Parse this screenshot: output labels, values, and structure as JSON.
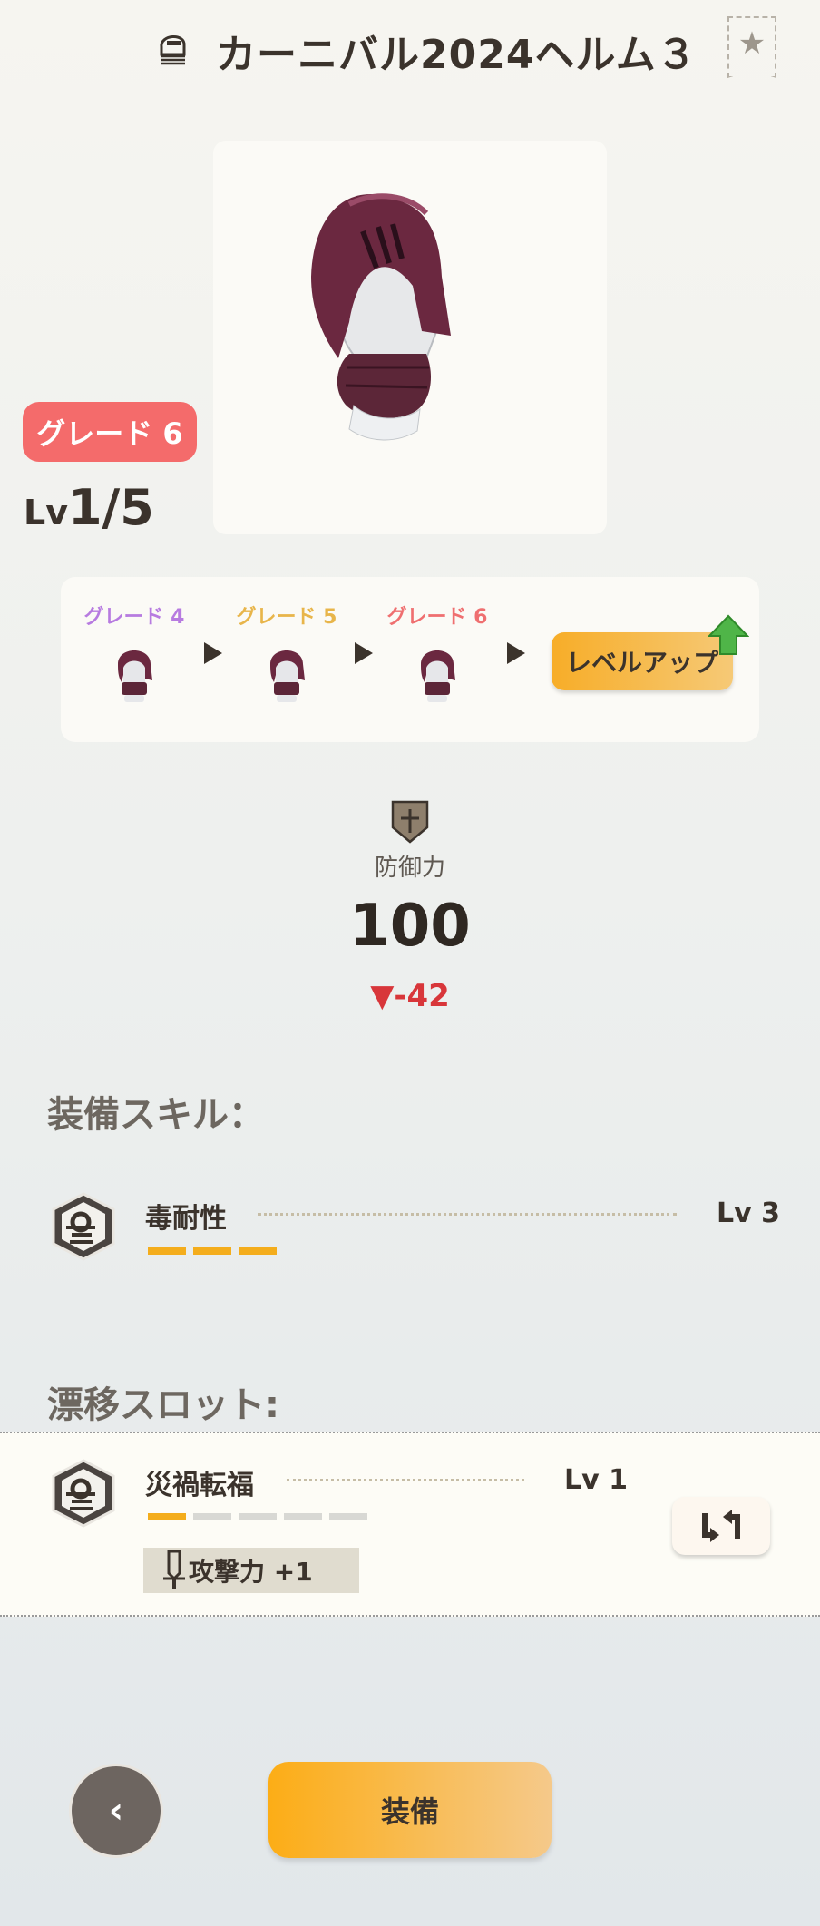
{
  "header": {
    "title": "カーニバル2024ヘルム３",
    "favorite_icon": "star-icon"
  },
  "item": {
    "grade_badge": "グレード 6",
    "level_prefix": "Lv",
    "level_value": "1/5",
    "image_icon": "helmet-icon"
  },
  "upgrade_path": {
    "steps": [
      {
        "label": "グレード 4",
        "color": "#b77be0"
      },
      {
        "label": "グレード 5",
        "color": "#e8b54a"
      },
      {
        "label": "グレード 6",
        "color": "#ef6f70"
      }
    ],
    "level_up_label": "レベルアップ"
  },
  "stat": {
    "label": "防御力",
    "value": "100",
    "diff": "▼-42"
  },
  "equipment_skills": {
    "title": "装備スキル：",
    "items": [
      {
        "name": "毒耐性",
        "level": "Lv 3",
        "pips_filled": 3,
        "pips_total": 3
      }
    ]
  },
  "drift_slot": {
    "title": "漂移スロット:",
    "items": [
      {
        "name": "災禍転福",
        "level": "Lv 1",
        "pips_filled": 1,
        "pips_total": 5
      }
    ],
    "bonus": "攻撃力 +1"
  },
  "buttons": {
    "back": "‹",
    "equip": "装備"
  },
  "colors": {
    "pip_on": "#f4ad1c",
    "pip_off": "#d8d8d4",
    "grade_badge": "#f46b6b",
    "diff_red": "#d8363a"
  }
}
